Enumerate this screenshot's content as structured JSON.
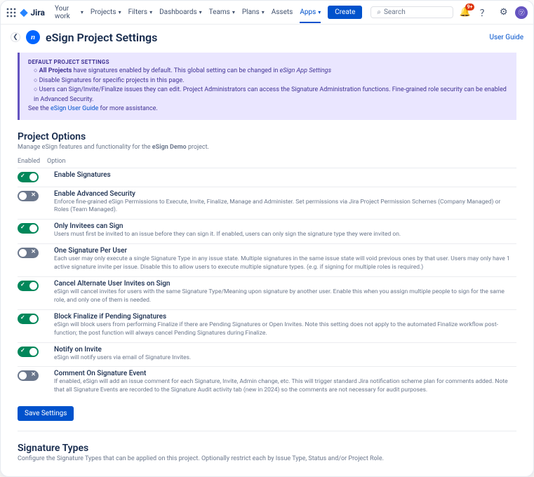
{
  "topbar": {
    "product": "Jira",
    "nav": [
      "Your work",
      "Projects",
      "Filters",
      "Dashboards",
      "Teams",
      "Plans",
      "Assets",
      "Apps"
    ],
    "create": "Create",
    "search_placeholder": "Search",
    "notif_count": "9+"
  },
  "header": {
    "title": "eSign Project Settings",
    "user_guide": "User Guide"
  },
  "callout": {
    "heading": "DEFAULT PROJECT SETTINGS",
    "lines": [
      "All Projects have signatures enabled by default. This global setting can be changed in eSign App Settings",
      "Disable Signatures for specific projects in this page.",
      "Users can Sign/Invite/Finalize issues they can edit. Project Administrators can access the Signature Administration functions. Fine-grained role security can be enabled in Advanced Security."
    ],
    "footer_prefix": "See the ",
    "footer_link": "eSign User Guide",
    "footer_suffix": " for more assistance."
  },
  "project_options": {
    "title": "Project Options",
    "sub_prefix": "Manage eSign features and functionality for the ",
    "sub_bold": "eSign Demo",
    "sub_suffix": " project.",
    "col_enabled": "Enabled",
    "col_option": "Option",
    "rows": [
      {
        "on": true,
        "title": "Enable Signatures",
        "desc": ""
      },
      {
        "on": false,
        "title": "Enable Advanced Security",
        "desc": "Enforce fine-grained eSign Permissions to Execute, Invite, Finalize, Manage and Administer. Set permissions via Jira Project Permission Schemes (Company Managed) or Roles (Team Managed)."
      },
      {
        "on": true,
        "title": "Only Invitees can Sign",
        "desc": "Users must first be invited to an issue before they can sign it. If enabled, users can only sign the signature type they were invited on."
      },
      {
        "on": false,
        "title": "One Signature Per User",
        "desc": "Each user may only execute a single Signature Type in any issue state. Multiple signatures in the same issue state will void previous ones by that user. Users may only have 1 active signature invite per issue. Disable this to allow users to execute multiple signature types. (e.g. if signing for multiple roles is required.)"
      },
      {
        "on": true,
        "title": "Cancel Alternate User Invites on Sign",
        "desc": "eSign will cancel invites for users with the same Signature Type/Meaning upon signature by another user. Enable this when you assign multiple people to sign for the same role, and only one of them is needed."
      },
      {
        "on": true,
        "title": "Block Finalize if Pending Signatures",
        "desc": "eSign will block users from performing Finalize if there are Pending Signatures or Open Invites. Note this setting does not apply to the automated Finalize workflow post-function; the post function will always cancel Pending Signatures during Finalize."
      },
      {
        "on": true,
        "title": "Notify on Invite",
        "desc": "eSign will notify users via email of Signature Invites."
      },
      {
        "on": false,
        "title": "Comment On Signature Event",
        "desc": "If enabled, eSign will add an issue comment for each Signature, Invite, Admin change, etc. This will trigger standard Jira notification scheme plan for comments added. Note that all Signature Events are recorded to the Signature Audit activity tab (new in 2024) so the comments are not necessary for audit purposes."
      }
    ],
    "save": "Save Settings"
  },
  "sig_types": {
    "title": "Signature Types",
    "sub": "Configure the Signature Types that can be applied on this project. Optionally restrict each by Issue Type, Status and/or Project Role."
  }
}
